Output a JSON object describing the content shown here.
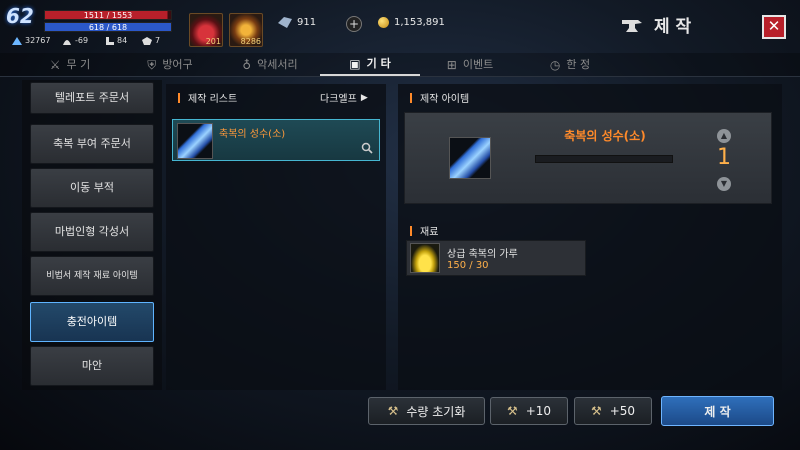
{
  "hud": {
    "level": "62",
    "hp_text": "1511 / 1553",
    "hp_fill": 0.973,
    "mp_text": "618 / 618",
    "mp_fill": 1.0,
    "stats": [
      {
        "icon": "power-icon",
        "value": "32767"
      },
      {
        "icon": "helmet-icon",
        "value": "-69"
      },
      {
        "icon": "boot-icon",
        "value": "84"
      },
      {
        "icon": "crest-icon",
        "value": "7"
      }
    ],
    "quick_items": [
      {
        "icon": "potion-red-icon",
        "count": "201"
      },
      {
        "icon": "food-icon",
        "count": "8286"
      }
    ],
    "crystal_count": "911",
    "gold_count": "1,153,891"
  },
  "window": {
    "title": "제 작",
    "close_label": "✕"
  },
  "tabs": [
    {
      "label": "무 기",
      "icon": "swords-icon",
      "active": false
    },
    {
      "label": "방어구",
      "icon": "shield-icon",
      "active": false
    },
    {
      "label": "악세서리",
      "icon": "amulet-icon",
      "active": false
    },
    {
      "label": "기 타",
      "icon": "box-icon",
      "active": true
    },
    {
      "label": "이벤트",
      "icon": "gift-icon",
      "active": false
    },
    {
      "label": "한 정",
      "icon": "timer-icon",
      "active": false
    }
  ],
  "categories": [
    {
      "label": "텔레포트 주문서",
      "active": false
    },
    {
      "label": "축복 부여 주문서",
      "active": false
    },
    {
      "label": "이동 부적",
      "active": false
    },
    {
      "label": "마법인형 각성서",
      "active": false
    },
    {
      "label": "비법서 제작 재료 아이템",
      "active": false
    },
    {
      "label": "충전아이템",
      "active": true
    },
    {
      "label": "마안",
      "active": false
    }
  ],
  "craft_list": {
    "header": "제작 리스트",
    "filter_label": "다크엘프",
    "items": [
      {
        "name": "축복의 성수(소)",
        "icon": "holy-water-icon"
      }
    ]
  },
  "craft_item": {
    "header": "제작 아이템",
    "name": "축복의 성수(소)",
    "quantity": "1"
  },
  "materials": {
    "header": "재료",
    "items": [
      {
        "name": "상급 축복의 가루",
        "count": "150 / 30",
        "icon": "dust-icon"
      }
    ]
  },
  "buttons": {
    "reset": "수량 초기화",
    "plus10": "+10",
    "plus50": "+50",
    "craft": "제 작"
  },
  "colors": {
    "accent_orange": "#ff8a2a",
    "selected_blue": "#5fb4ff",
    "hp_red": "#b8202a",
    "mp_blue": "#2b58c9"
  }
}
